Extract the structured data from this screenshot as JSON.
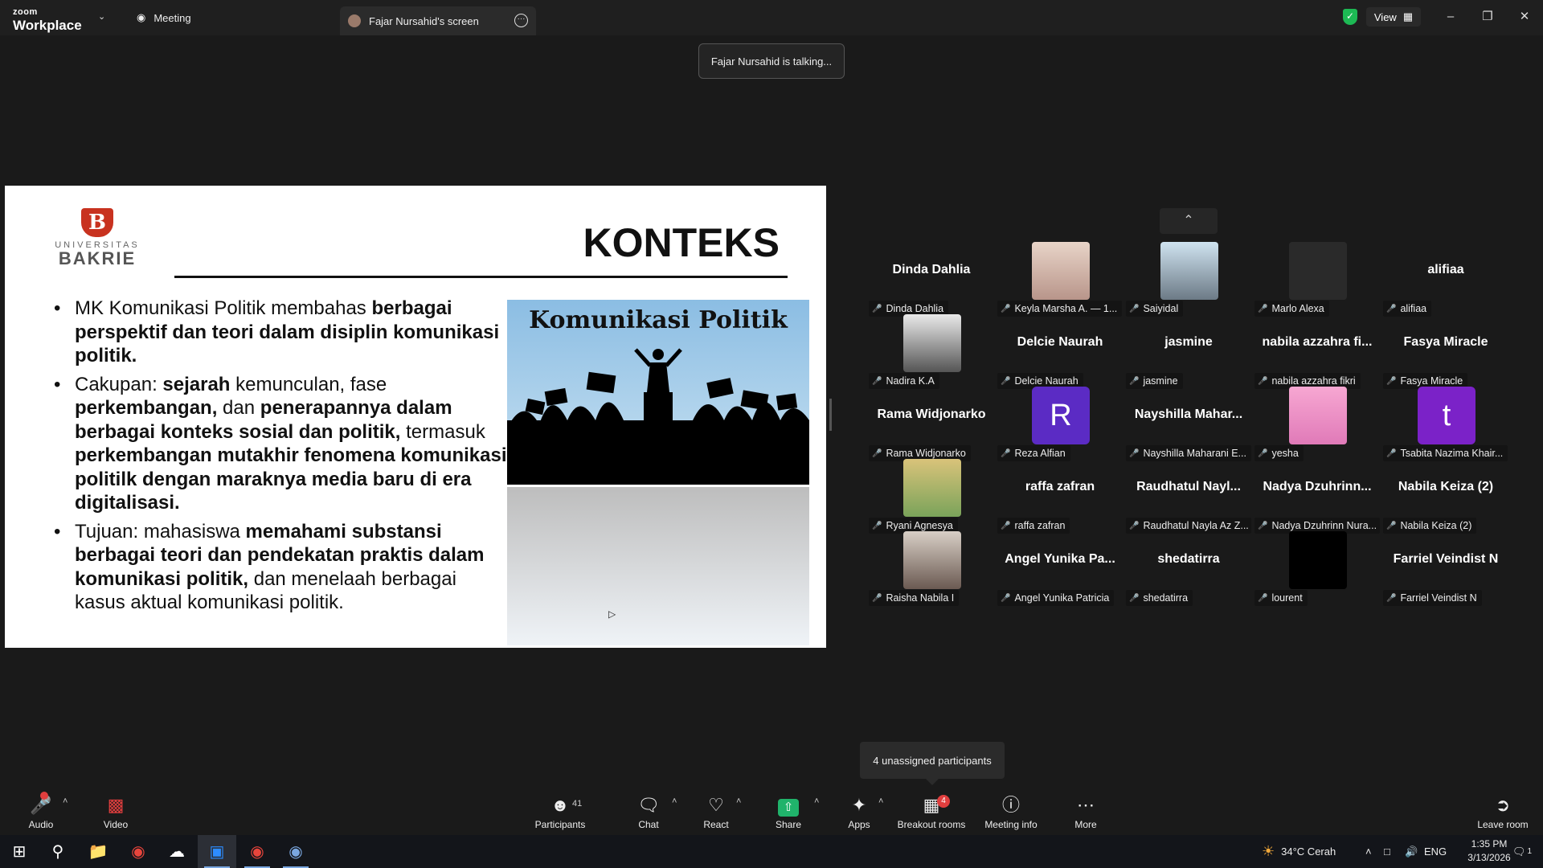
{
  "titlebar": {
    "logo_top": "zoom",
    "logo_bottom": "Workplace",
    "tab_meeting": "Meeting",
    "tab_screen": "Fajar Nursahid's screen",
    "view_label": "View"
  },
  "talking_toast": "Fajar Nursahid is talking...",
  "slide": {
    "logo_line1": "UNIVERSITAS",
    "logo_line2": "BAKRIE",
    "title": "KONTEKS",
    "image_title": "Komunikasi Politik",
    "b1_a": "MK Komunikasi Politik membahas ",
    "b1_b": "berbagai perspektif dan teori dalam disiplin komunikasi politik.",
    "b2_a": "Cakupan: ",
    "b2_b": "sejarah",
    "b2_c": " kemunculan, fase ",
    "b2_d": "perkembangan,",
    "b2_e": " dan ",
    "b2_f": "penerapannya dalam berbagai konteks sosial dan politik,",
    "b2_g": " termasuk ",
    "b2_h": "perkembangan mutakhir fenomena komunikasi politilk dengan maraknya media baru di era digitalisasi.",
    "b3_a": "Tujuan: mahasiswa ",
    "b3_b": "memahami substansi berbagai teori dan pendekatan praktis dalam komunikasi politik,",
    "b3_c": " dan menelaah berbagai kasus aktual komunikasi politik."
  },
  "gallery": [
    {
      "display": "Dinda Dahlia",
      "label": "Dinda Dahlia"
    },
    {
      "display": "",
      "label": "Keyla Marsha A. — 1..."
    },
    {
      "display": "",
      "label": "Saiyidal"
    },
    {
      "display": "",
      "label": "Marlo Alexa"
    },
    {
      "display": "alifiaa",
      "label": "alifiaa"
    },
    {
      "display": "",
      "label": "Nadira K.A"
    },
    {
      "display": "Delcie Naurah",
      "label": "Delcie Naurah"
    },
    {
      "display": "jasmine",
      "label": "jasmine"
    },
    {
      "display": "nabila azzahra fi...",
      "label": "nabila azzahra fikri"
    },
    {
      "display": "Fasya Miracle",
      "label": "Fasya Miracle"
    },
    {
      "display": "Rama Widjonarko",
      "label": "Rama Widjonarko"
    },
    {
      "display": "R",
      "label": "Reza Alfian"
    },
    {
      "display": "Nayshilla Mahar...",
      "label": "Nayshilla Maharani E..."
    },
    {
      "display": "",
      "label": "yesha"
    },
    {
      "display": "t",
      "label": "Tsabita Nazima Khair..."
    },
    {
      "display": "",
      "label": "Ryani Agnesya"
    },
    {
      "display": "raffa zafran",
      "label": "raffa zafran"
    },
    {
      "display": "Raudhatul Nayl...",
      "label": "Raudhatul Nayla Az Z..."
    },
    {
      "display": "Nadya Dzuhrinn...",
      "label": "Nadya Dzuhrinn Nura..."
    },
    {
      "display": "Nabila Keiza (2)",
      "label": "Nabila Keiza (2)"
    },
    {
      "display": "",
      "label": "Raisha Nabila I"
    },
    {
      "display": "Angel Yunika Pa...",
      "label": "Angel Yunika Patricia"
    },
    {
      "display": "shedatirra",
      "label": "shedatirra"
    },
    {
      "display": "",
      "label": "lourent"
    },
    {
      "display": "Farriel Veindist N",
      "label": "Farriel Veindist N"
    }
  ],
  "unassigned": "4 unassigned participants",
  "toolbar": {
    "audio": "Audio",
    "video": "Video",
    "participants": "Participants",
    "participants_count": "41",
    "chat": "Chat",
    "react": "React",
    "share": "Share",
    "apps": "Apps",
    "breakout": "Breakout rooms",
    "breakout_badge": "4",
    "meeting_info": "Meeting info",
    "more": "More",
    "leave": "Leave room"
  },
  "taskbar": {
    "weather": "34°C  Cerah",
    "lang": "ENG",
    "time": "1:35 PM",
    "date": "3/13/2026",
    "notif": "1"
  },
  "colors": {
    "accent_green": "#20b36b",
    "muted_red": "#e03e3e",
    "avatar_purple": "#5b2bc4"
  }
}
